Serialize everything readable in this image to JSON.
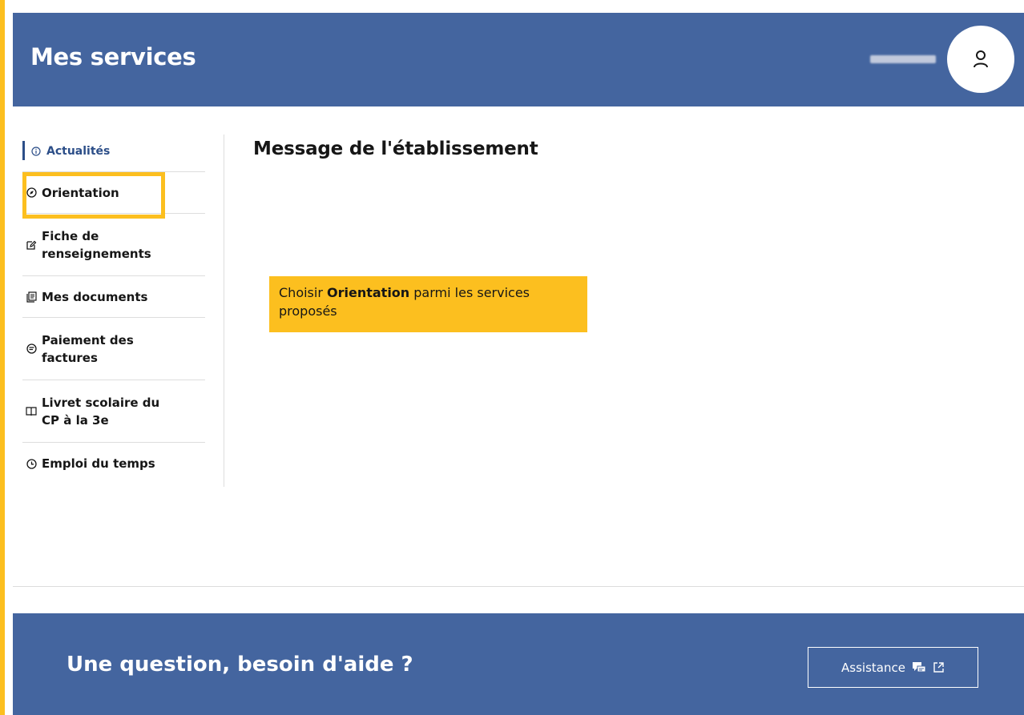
{
  "header": {
    "title": "Mes services",
    "avatar_icon": "user-icon"
  },
  "sidebar": {
    "items": [
      {
        "label": "Actualités",
        "icon": "info-icon"
      },
      {
        "label": "Orientation",
        "icon": "compass-icon"
      },
      {
        "label": "Fiche de renseignements",
        "icon": "edit-icon"
      },
      {
        "label": "Mes documents",
        "icon": "document-icon"
      },
      {
        "label": "Paiement des factures",
        "icon": "payment-icon"
      },
      {
        "label": "Livret scolaire du CP à la 3e",
        "icon": "book-icon"
      },
      {
        "label": "Emploi du temps",
        "icon": "clock-icon"
      }
    ]
  },
  "main": {
    "title": "Message de l'établissement"
  },
  "callout": {
    "prefix": "Choisir ",
    "bold": "Orientation",
    "suffix": " parmi les services proposés"
  },
  "footer": {
    "title": "Une question, besoin d'aide ?",
    "assist_label": "Assistance"
  },
  "colors": {
    "brand_blue": "#44659f",
    "active_blue": "#2c4e88",
    "highlight_yellow": "#fcbf1f"
  }
}
